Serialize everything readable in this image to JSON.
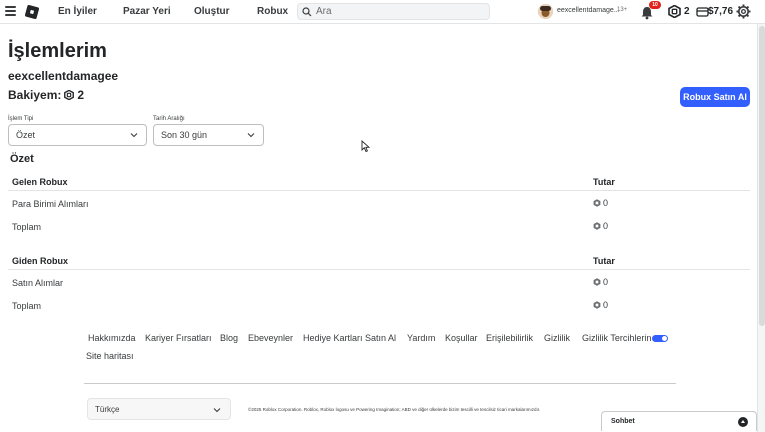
{
  "nav": {
    "links": [
      "En İyiler",
      "Pazar Yeri",
      "Oluştur",
      "Robux"
    ],
    "search_placeholder": "Ara",
    "username": "eexcellentdamage...",
    "age_label": "13+",
    "notification_count": "10",
    "robux_balance": "2",
    "money": "$7,76"
  },
  "page": {
    "title": "İşlemlerim",
    "user": "eexcellentdamagee",
    "balance_label": "Bakiyem:",
    "balance_value": "2",
    "buy_button": "Robux Satın Al"
  },
  "filters": {
    "type_label": "İşlem Tipi",
    "type_value": "Özet",
    "range_label": "Tarih Aralığı",
    "range_value": "Son 30 gün"
  },
  "summary": {
    "title": "Özet",
    "incoming": {
      "header_left": "Gelen Robux",
      "header_right": "Tutar",
      "rows": [
        {
          "label": "Para Birimi Alımları",
          "value": "0"
        },
        {
          "label": "Toplam",
          "value": "0"
        }
      ]
    },
    "outgoing": {
      "header_left": "Giden Robux",
      "header_right": "Tutar",
      "rows": [
        {
          "label": "Satın Alımlar",
          "value": "0"
        },
        {
          "label": "Toplam",
          "value": "0"
        }
      ]
    }
  },
  "footer": {
    "links": [
      "Hakkımızda",
      "Kariyer Fırsatları",
      "Blog",
      "Ebeveynler",
      "Hediye Kartları Satın Al",
      "Yardım",
      "Koşullar",
      "Erişilebilirlik",
      "Gizlilik",
      "Gizlilik Tercihlerin",
      "Site haritası"
    ],
    "language": "Türkçe",
    "copyright": "©2025 Roblox Corporation. Roblox, Roblox logosu ve Powering Imagination; ABD ve diğer ülkelerde bizim tescilli ve tescilsiz ticari markalarımızdır."
  },
  "chat": {
    "label": "Sohbet"
  },
  "colors": {
    "accent": "#335fff",
    "notification": "#e2231a"
  }
}
